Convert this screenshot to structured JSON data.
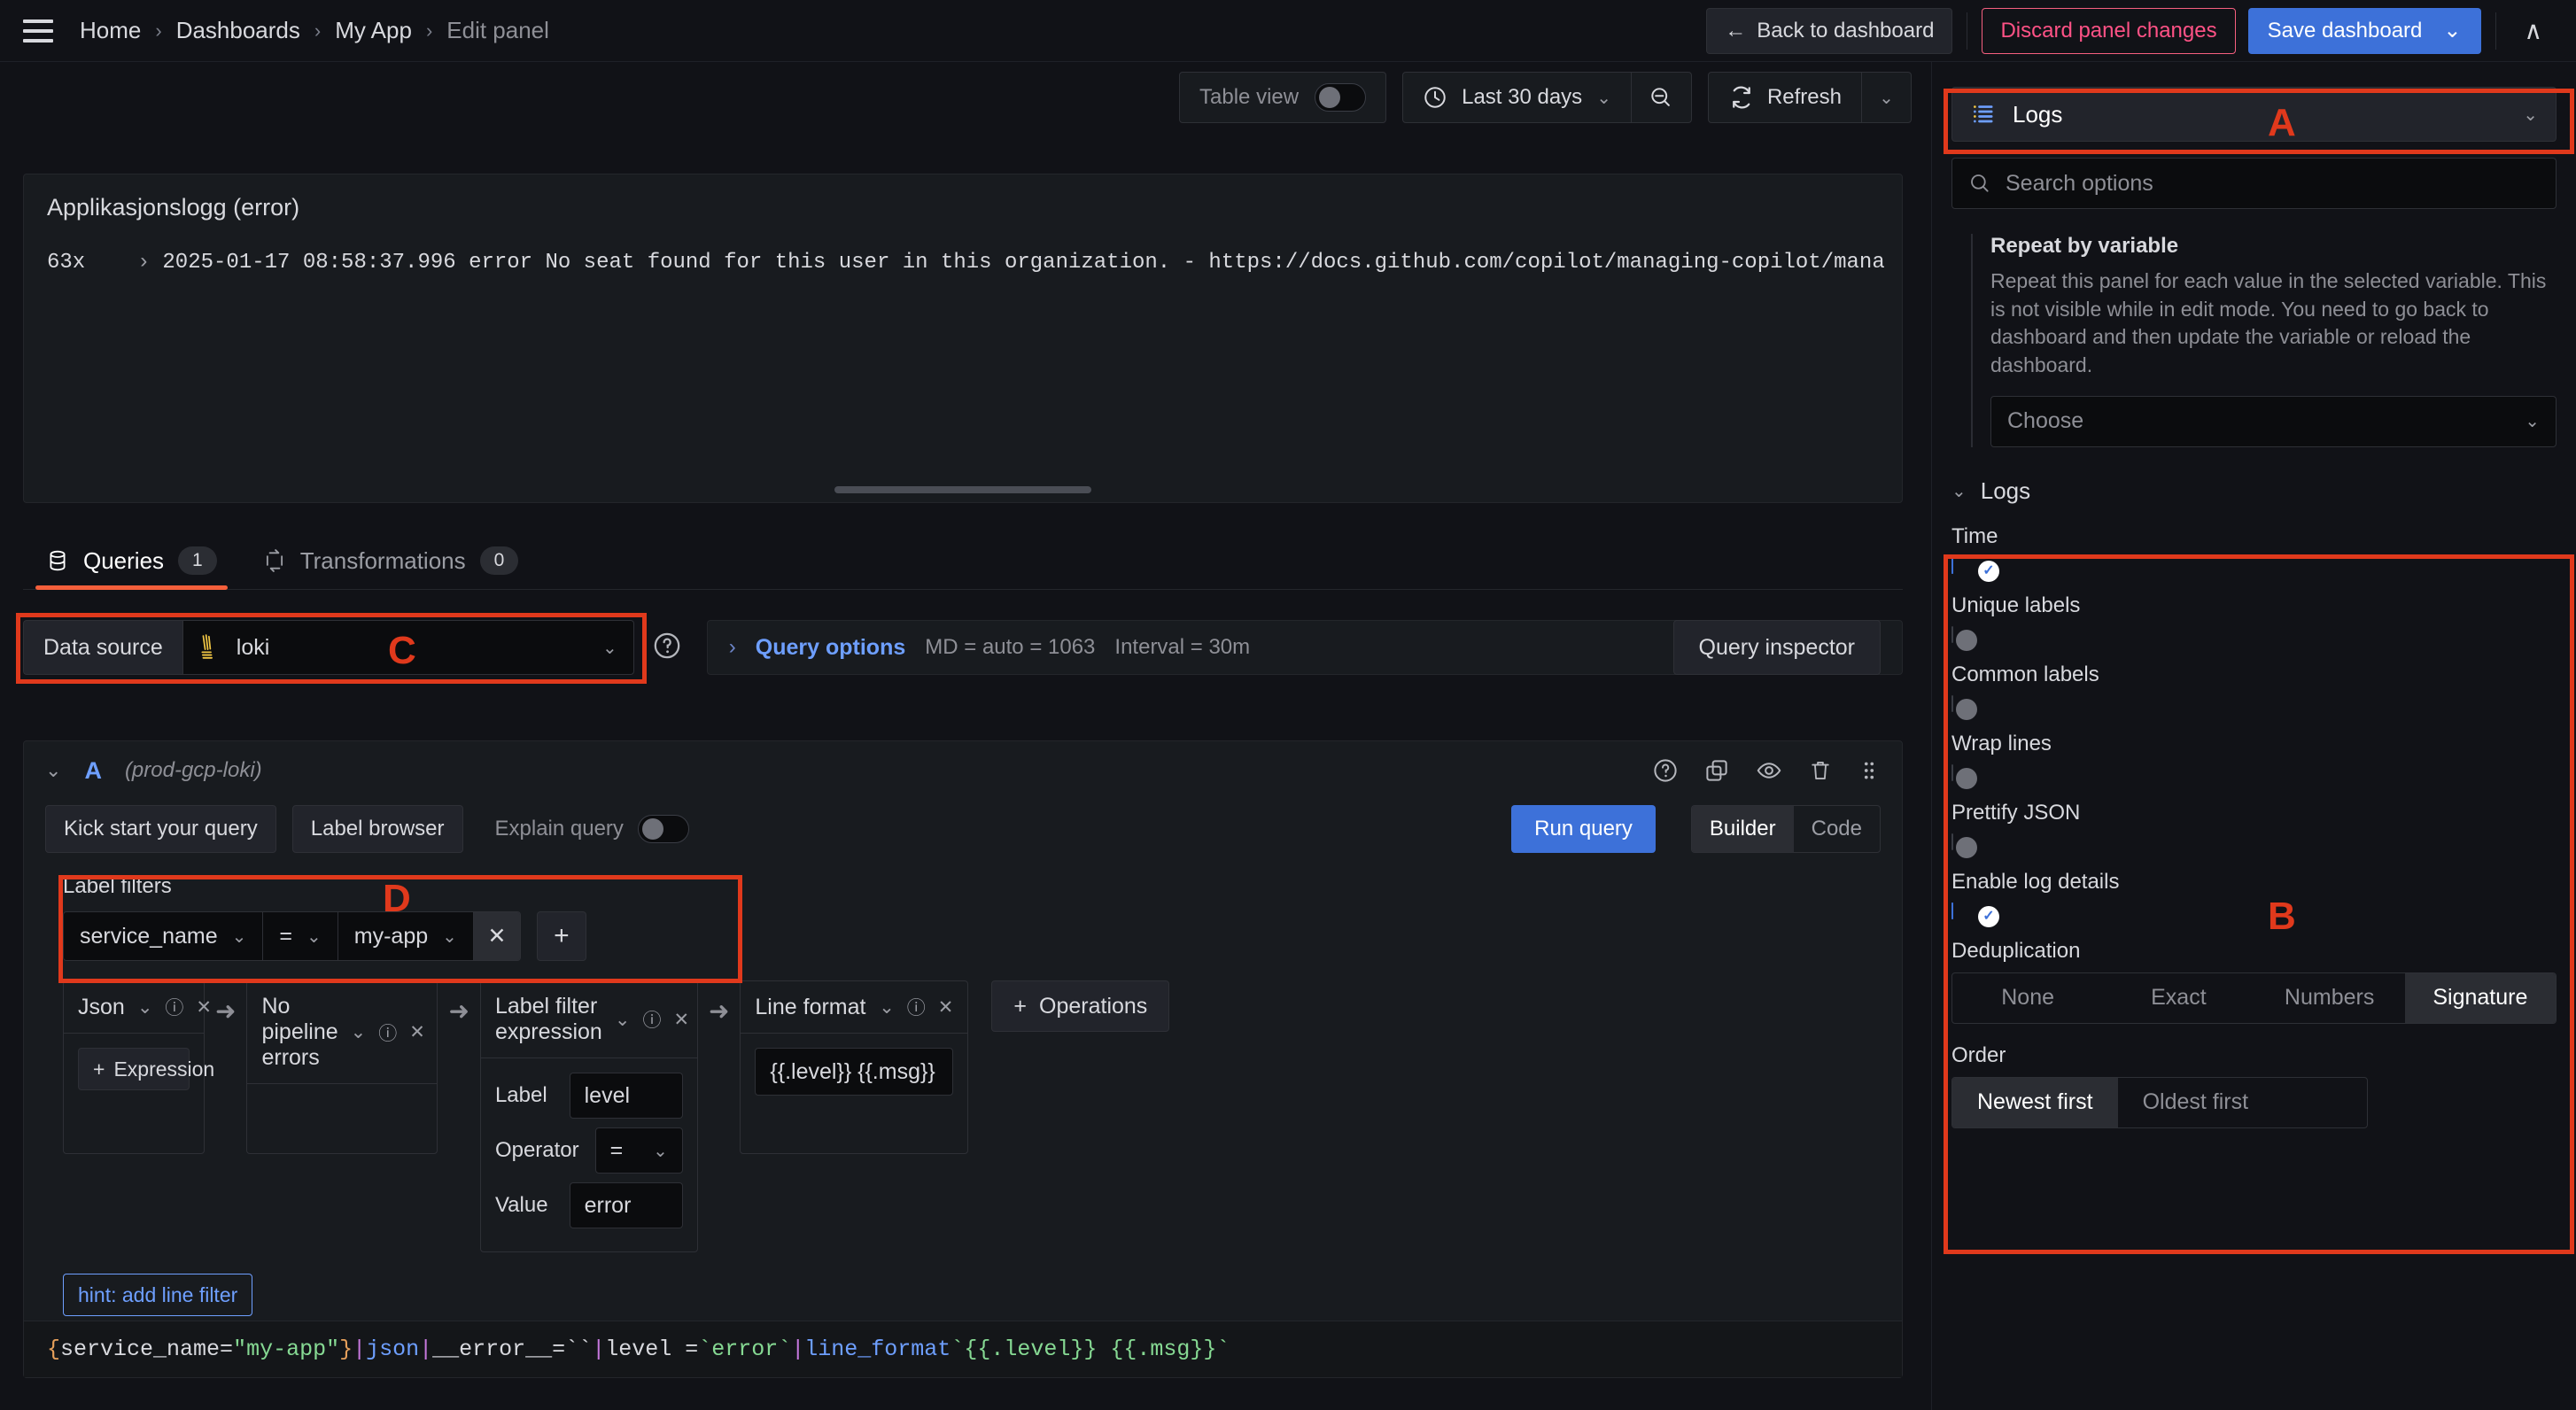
{
  "nav": {
    "menu_icon": "hamburger-icon",
    "breadcrumbs": [
      "Home",
      "Dashboards",
      "My App",
      "Edit panel"
    ],
    "separator": "›",
    "back_label": "Back to dashboard",
    "back_icon": "arrow-left-icon",
    "discard_label": "Discard panel changes",
    "save_label": "Save dashboard",
    "save_caret": "⌄",
    "collapse_icon": "chevron-up-icon"
  },
  "toolbar": {
    "table_view_label": "Table view",
    "table_view_on": false,
    "time_icon": "clock-icon",
    "time_range": "Last 30 days",
    "time_caret": "⌄",
    "zoom_out_icon": "zoom-out-icon",
    "refresh_icon": "refresh-icon",
    "refresh_label": "Refresh",
    "refresh_caret": "⌄"
  },
  "panel": {
    "title": "Applikasjonslogg (error)",
    "log_count": "63x",
    "log_chevron": "›",
    "log_line": "2025-01-17 08:58:37.996 error No seat found for this user in this organization. - https://docs.github.com/copilot/managing-copilot/mana"
  },
  "tabs": [
    {
      "label": "Queries",
      "count": "1",
      "icon": "database-icon",
      "active": true
    },
    {
      "label": "Transformations",
      "count": "0",
      "icon": "transform-icon",
      "active": false
    }
  ],
  "datasource": {
    "label": "Data source",
    "value": "loki",
    "icon": "loki-icon",
    "caret": "⌄",
    "help_icon": "help-circle-icon",
    "query_options_caret": "›",
    "query_options_label": "Query options",
    "max_data_points": "MD = auto = 1063",
    "interval": "Interval = 30m",
    "query_inspector_label": "Query inspector"
  },
  "query": {
    "collapse_icon": "chevron-down-icon",
    "ref_id": "A",
    "datasource_name": "(prod-gcp-loki)",
    "row_icons": [
      "help-circle-icon",
      "duplicate-icon",
      "eye-icon",
      "trash-icon",
      "drag-handle-icon"
    ],
    "kick_start_label": "Kick start your query",
    "label_browser_label": "Label browser",
    "explain_label": "Explain query",
    "explain_on": false,
    "run_query_label": "Run query",
    "mode_options": [
      "Builder",
      "Code"
    ],
    "mode_selected": "Builder",
    "label_filters": {
      "title": "Label filters",
      "key": "service_name",
      "operator": "=",
      "value": "my-app",
      "remove_icon": "✕",
      "add_icon": "+",
      "caret": "⌄"
    },
    "operations": [
      {
        "name": "Json",
        "caret": "⌄",
        "info_icon": "info-circle-icon",
        "remove_icon": "✕",
        "body_type": "expression",
        "expression_label": "Expression",
        "expression_icon": "+"
      },
      {
        "name": "No pipeline errors",
        "caret": "⌄",
        "info_icon": "info-circle-icon",
        "remove_icon": "✕",
        "body_type": "empty"
      },
      {
        "name": "Label filter expression",
        "caret": "⌄",
        "info_icon": "info-circle-icon",
        "remove_icon": "✕",
        "body_type": "kv",
        "fields": [
          {
            "label": "Label",
            "value": "level",
            "kind": "text"
          },
          {
            "label": "Operator",
            "value": "=",
            "kind": "select"
          },
          {
            "label": "Value",
            "value": "error",
            "kind": "text"
          }
        ]
      },
      {
        "name": "Line format",
        "caret": "⌄",
        "info_icon": "info-circle-icon",
        "remove_icon": "✕",
        "body_type": "format",
        "format_value": "{{.level}} {{.msg}}"
      }
    ],
    "operations_button_label": "Operations",
    "operations_button_icon": "+",
    "arrow_icon": "arrow-right-icon",
    "hint_label": "hint: add line filter",
    "logql": [
      {
        "text": "{",
        "cls": "t-brace"
      },
      {
        "text": "service_name=",
        "cls": "t-key"
      },
      {
        "text": "\"my-app\"",
        "cls": "t-str"
      },
      {
        "text": "}",
        "cls": "t-brace"
      },
      {
        "text": " | ",
        "cls": "t-pipe"
      },
      {
        "text": "json",
        "cls": "t-fn"
      },
      {
        "text": " | ",
        "cls": "t-pipe"
      },
      {
        "text": "__error__=``",
        "cls": "t-plain"
      },
      {
        "text": " | ",
        "cls": "t-pipe"
      },
      {
        "text": "level = ",
        "cls": "t-plain"
      },
      {
        "text": "`error`",
        "cls": "t-str"
      },
      {
        "text": " | ",
        "cls": "t-pipe"
      },
      {
        "text": "line_format",
        "cls": "t-fn"
      },
      {
        "text": " `{{.level}} {{.msg}}`",
        "cls": "t-str"
      }
    ]
  },
  "sidebar": {
    "viz_icon": "logs-list-icon",
    "viz_name": "Logs",
    "viz_caret": "⌄",
    "search_icon": "search-icon",
    "search_placeholder": "Search options",
    "repeat": {
      "title": "Repeat by variable",
      "description": "Repeat this panel for each value in the selected variable. This is not visible while in edit mode. You need to go back to dashboard and then update the variable or reload the dashboard.",
      "choose_label": "Choose",
      "caret": "⌄"
    },
    "logs_section": {
      "title": "Logs",
      "collapse_icon": "chevron-down-icon",
      "toggles": [
        {
          "label": "Time",
          "on": true
        },
        {
          "label": "Unique labels",
          "on": false
        },
        {
          "label": "Common labels",
          "on": false
        },
        {
          "label": "Wrap lines",
          "on": false
        },
        {
          "label": "Prettify JSON",
          "on": false
        },
        {
          "label": "Enable log details",
          "on": true
        }
      ],
      "deduplication": {
        "label": "Deduplication",
        "options": [
          "None",
          "Exact",
          "Numbers",
          "Signature"
        ],
        "selected": "Signature"
      },
      "order": {
        "label": "Order",
        "options": [
          "Newest first",
          "Oldest first"
        ],
        "selected": "Newest first"
      }
    }
  },
  "annotations": [
    {
      "letter": "A",
      "target": "visualization-picker"
    },
    {
      "letter": "B",
      "target": "logs-options-section"
    },
    {
      "letter": "C",
      "target": "data-source-picker"
    },
    {
      "letter": "D",
      "target": "label-filters"
    }
  ],
  "colors": {
    "accent_blue": "#3d71d9",
    "annotation_red": "#e0391c",
    "danger_pink": "#ff5286",
    "tab_active": "#f55f3b"
  }
}
